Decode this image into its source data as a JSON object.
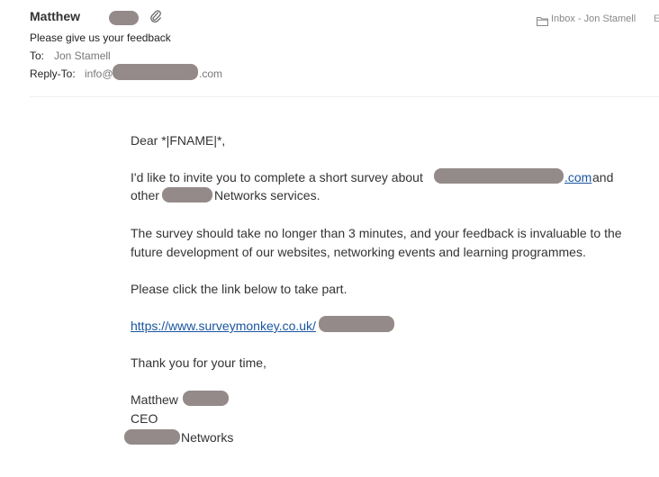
{
  "header": {
    "sender_name": "Matthew",
    "subject": "Please give us your feedback",
    "to_label": "To:",
    "to_value": "Jon Stamell",
    "replyto_label": "Reply-To:",
    "replyto_prefix": "info@",
    "replyto_suffix": ".com",
    "folder_text": "Inbox - Jon Stamell",
    "more_indicator": "E"
  },
  "body": {
    "greeting": "Dear *|FNAME|*,",
    "p1_part1": "I'd like to invite you to complete a short survey about",
    "p1_link": ".com",
    "p1_and": "and",
    "p1_other": "other",
    "p1_networks": "Networks services.",
    "p2_line1": "The survey should take no longer than 3 minutes, and your feedback is invaluable to the",
    "p2_line2": "future development of our websites, networking events and learning programmes.",
    "p3": "Please click the link below to take part.",
    "survey_link": "https://www.surveymonkey.co.uk/",
    "thanks": "Thank you for your time,",
    "sig_name": "Matthew",
    "sig_title": "CEO",
    "sig_company": "Networks"
  },
  "icons": {
    "paperclip": "paperclip-icon",
    "folder": "folder-icon"
  },
  "colors": {
    "redaction": "#948a8a",
    "link": "#1b55a0"
  }
}
